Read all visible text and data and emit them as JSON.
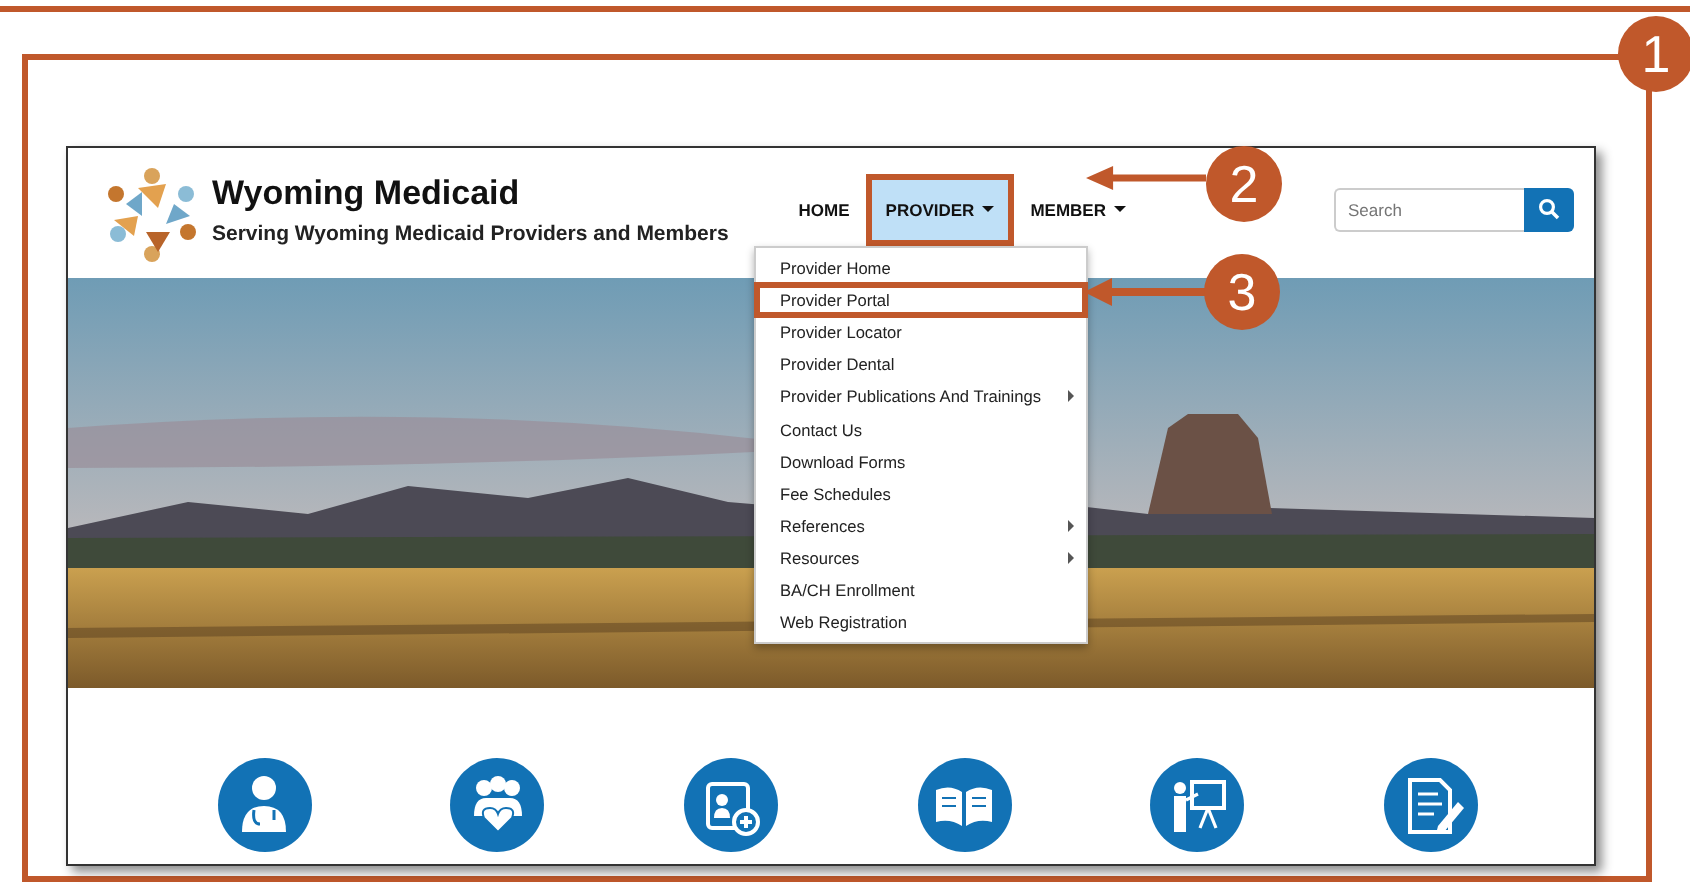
{
  "callouts": [
    {
      "label": "1"
    },
    {
      "label": "2"
    },
    {
      "label": "3"
    }
  ],
  "site": {
    "title": "Wyoming Medicaid",
    "tagline": "Serving Wyoming Medicaid Providers and Members",
    "nav": [
      {
        "label": "HOME",
        "dropdown": false,
        "selected": false,
        "highlighted": false
      },
      {
        "label": "PROVIDER",
        "dropdown": true,
        "selected": true,
        "highlighted": true
      },
      {
        "label": "MEMBER",
        "dropdown": true,
        "selected": false,
        "highlighted": false
      }
    ],
    "search": {
      "placeholder": "Search"
    },
    "menu": [
      {
        "label": "Provider Home",
        "submenu": false,
        "highlighted": false
      },
      {
        "label": "Provider Portal",
        "submenu": false,
        "highlighted": true
      },
      {
        "label": "Provider Locator",
        "submenu": false,
        "highlighted": false
      },
      {
        "label": "Provider Dental",
        "submenu": false,
        "highlighted": false
      },
      {
        "label": "Provider Publications And Trainings",
        "submenu": true,
        "highlighted": false
      },
      {
        "label": "Contact Us",
        "submenu": false,
        "highlighted": false
      },
      {
        "label": "Download Forms",
        "submenu": false,
        "highlighted": false
      },
      {
        "label": "Fee Schedules",
        "submenu": false,
        "highlighted": false
      },
      {
        "label": "References",
        "submenu": true,
        "highlighted": false
      },
      {
        "label": "Resources",
        "submenu": true,
        "highlighted": false
      },
      {
        "label": "BA/CH Enrollment",
        "submenu": false,
        "highlighted": false
      },
      {
        "label": "Web Registration",
        "submenu": false,
        "highlighted": false
      }
    ],
    "features": [
      {
        "kind": "doctor"
      },
      {
        "kind": "family"
      },
      {
        "kind": "card"
      },
      {
        "kind": "book"
      },
      {
        "kind": "presenter"
      },
      {
        "kind": "form"
      }
    ]
  }
}
